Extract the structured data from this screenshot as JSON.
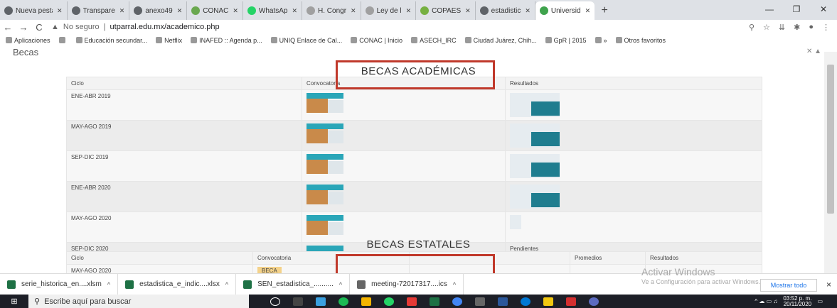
{
  "browser": {
    "tabs": [
      {
        "label": "Nueva pesta",
        "color": "#5f6368"
      },
      {
        "label": "Transpare",
        "color": "#5f6368"
      },
      {
        "label": "anexo49",
        "color": "#5f6368"
      },
      {
        "label": "CONAC",
        "color": "#6aa84f"
      },
      {
        "label": "WhatsAp",
        "color": "#25d366"
      },
      {
        "label": "H. Congr",
        "color": "#a0a0a0"
      },
      {
        "label": "Ley de l",
        "color": "#a0a0a0"
      },
      {
        "label": "COPAES",
        "color": "#76b041"
      },
      {
        "label": "estadistic",
        "color": "#5f6368"
      },
      {
        "label": "Universid",
        "color": "#3fa34d",
        "active": true
      }
    ],
    "address": {
      "security": "No seguro",
      "url": "utparral.edu.mx/academico.php"
    },
    "bookmarks": [
      "Aplicaciones",
      "",
      "Educación secundar...",
      "Netflix",
      "INAFED :: Agenda p...",
      "UNIQ Enlace de Cal...",
      "CONAC | Inicio",
      "ASECH_IRC",
      "Ciudad Juárez, Chih...",
      "GpR | 2015",
      "»",
      "Otros favoritos"
    ]
  },
  "page": {
    "header": "Becas",
    "academicas": {
      "title": "BECAS ACADÉMICAS",
      "columns": [
        "Ciclo",
        "Convocatoria",
        "Resultados"
      ],
      "rows": [
        {
          "ciclo": "ENE-ABR 2019",
          "resultado": ""
        },
        {
          "ciclo": "MAY-AGO 2019",
          "resultado": ""
        },
        {
          "ciclo": "SEP-DIC 2019",
          "resultado": ""
        },
        {
          "ciclo": "ENE-ABR 2020",
          "resultado": ""
        },
        {
          "ciclo": "MAY-AGO 2020",
          "resultado": ""
        },
        {
          "ciclo": "SEP-DIC 2020",
          "resultado": "Pendientes"
        }
      ]
    },
    "estatales": {
      "title": "BECAS ESTATALES",
      "columns": [
        "Ciclo",
        "Convocatoria",
        "",
        "Promedios",
        "Resultados"
      ],
      "rows": [
        {
          "ciclo": "MAY-AGO 2020",
          "convocatoria": "BECA"
        }
      ]
    }
  },
  "downloads": {
    "items": [
      "serie_historica_en....xlsm",
      "estadistica_e_indic....xlsx",
      "SEN_estadistica_..........",
      "meeting-72017317....ics"
    ],
    "show_all": "Mostrar todo",
    "close": "×"
  },
  "watermark": {
    "line1": "Activar Windows",
    "line2": "Ve a Configuración para activar Windows."
  },
  "taskbar": {
    "search_placeholder": "Escribe aquí para buscar",
    "time": "03:52 p. m.",
    "date": "20/11/2020"
  },
  "colors": {
    "highlight_box": "#c0392b",
    "taskbar": "#1d1f27"
  }
}
